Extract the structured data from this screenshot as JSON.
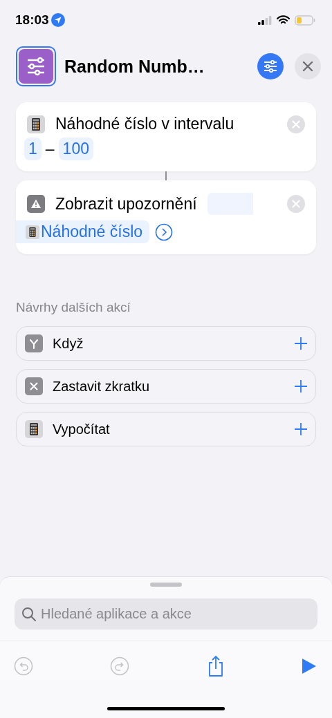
{
  "status_bar": {
    "time": "18:03"
  },
  "header": {
    "title": "Random Numb…"
  },
  "actions": [
    {
      "kind": "random",
      "title": "Náhodné číslo v intervalu",
      "min": "1",
      "dash": "–",
      "max": "100"
    },
    {
      "kind": "alert",
      "title": "Zobrazit upozornění",
      "variable": "Náhodné číslo"
    }
  ],
  "suggestions": {
    "heading": "Návrhy dalších akcí",
    "items": [
      {
        "kind": "branch",
        "label": "Když"
      },
      {
        "kind": "stop",
        "label": "Zastavit zkratku"
      },
      {
        "kind": "calculator",
        "label": "Vypočítat"
      }
    ]
  },
  "search": {
    "placeholder": "Hledané aplikace a akce"
  },
  "toolbar": [
    {
      "kind": "undo",
      "disabled": true
    },
    {
      "kind": "redo",
      "disabled": true
    },
    {
      "kind": "share",
      "disabled": false
    },
    {
      "kind": "run",
      "disabled": false
    }
  ]
}
